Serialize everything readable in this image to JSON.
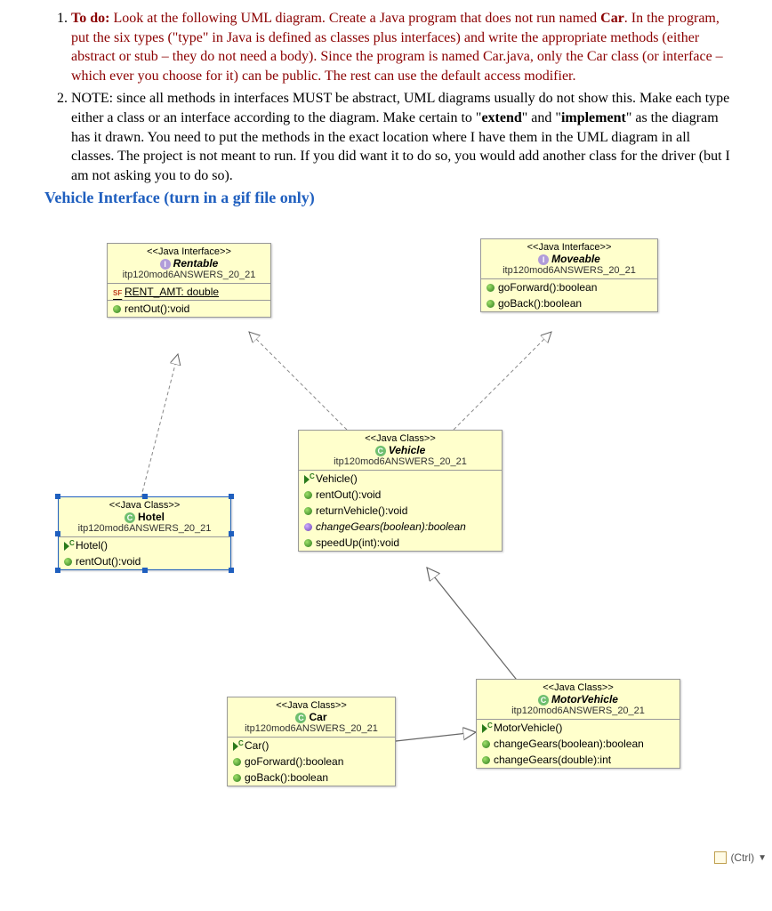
{
  "instructions": {
    "item1_prefix": "To do:",
    "item1_body": " Look at the following UML diagram.  Create a Java program that does not run named ",
    "item1_bold1": "Car",
    "item1_after_bold1": ".   In the program, put the six types (\"type\" in Java is defined as classes plus interfaces) and write the appropriate methods (either abstract or stub – they do not need a body).  Since the program is named Car.java, only the Car class (or interface – which ever you choose for it) can be public.  The rest can use the default access modifier.",
    "item2_prefix": " NOTE: since all methods in interfaces MUST be abstract, UML diagrams usually do not show this. Make each type either a class or an interface according to the diagram.  Make certain to \"",
    "item2_bold1": "extend",
    "item2_mid1": "\" and \"",
    "item2_bold2": "implement",
    "item2_after": "\" as the diagram has it drawn. You need to put the methods in the exact location where I have them in the UML diagram in all classes. The project is not meant to run.  If you did want it to do so, you would add another class for the driver (but I am not asking you to do so)."
  },
  "heading": "Vehicle Interface (turn in a gif file only)",
  "uml": {
    "rentable": {
      "stereotype": "<<Java Interface>>",
      "name": "Rentable",
      "package": "itp120mod6ANSWERS_20_21",
      "attrs": [
        {
          "icon": "sf",
          "text": "RENT_AMT: double",
          "static": true
        }
      ],
      "ops": [
        {
          "icon": "green",
          "text": "rentOut():void"
        }
      ]
    },
    "moveable": {
      "stereotype": "<<Java Interface>>",
      "name": "Moveable",
      "package": "itp120mod6ANSWERS_20_21",
      "ops": [
        {
          "icon": "green",
          "text": "goForward():boolean"
        },
        {
          "icon": "green",
          "text": "goBack():boolean"
        }
      ]
    },
    "vehicle": {
      "stereotype": "<<Java Class>>",
      "name": "Vehicle",
      "package": "itp120mod6ANSWERS_20_21",
      "ops": [
        {
          "icon": "ctor",
          "text": "Vehicle()"
        },
        {
          "icon": "green",
          "text": "rentOut():void"
        },
        {
          "icon": "green",
          "text": "returnVehicle():void"
        },
        {
          "icon": "purple",
          "text": "changeGears(boolean):boolean",
          "abstract": true
        },
        {
          "icon": "green",
          "text": "speedUp(int):void"
        }
      ]
    },
    "hotel": {
      "stereotype": "<<Java Class>>",
      "name": "Hotel",
      "package": "itp120mod6ANSWERS_20_21",
      "ops": [
        {
          "icon": "ctor",
          "text": "Hotel()"
        },
        {
          "icon": "green",
          "text": "rentOut():void"
        }
      ]
    },
    "motorvehicle": {
      "stereotype": "<<Java Class>>",
      "name": "MotorVehicle",
      "package": "itp120mod6ANSWERS_20_21",
      "ops": [
        {
          "icon": "ctor",
          "text": "MotorVehicle()"
        },
        {
          "icon": "green",
          "text": "changeGears(boolean):boolean"
        },
        {
          "icon": "green",
          "text": "changeGears(double):int"
        }
      ]
    },
    "car": {
      "stereotype": "<<Java Class>>",
      "name": "Car",
      "package": "itp120mod6ANSWERS_20_21",
      "ops": [
        {
          "icon": "ctor",
          "text": "Car()"
        },
        {
          "icon": "green",
          "text": "goForward():boolean"
        },
        {
          "icon": "green",
          "text": "goBack():boolean"
        }
      ]
    }
  },
  "footer": {
    "label": "(Ctrl)"
  }
}
